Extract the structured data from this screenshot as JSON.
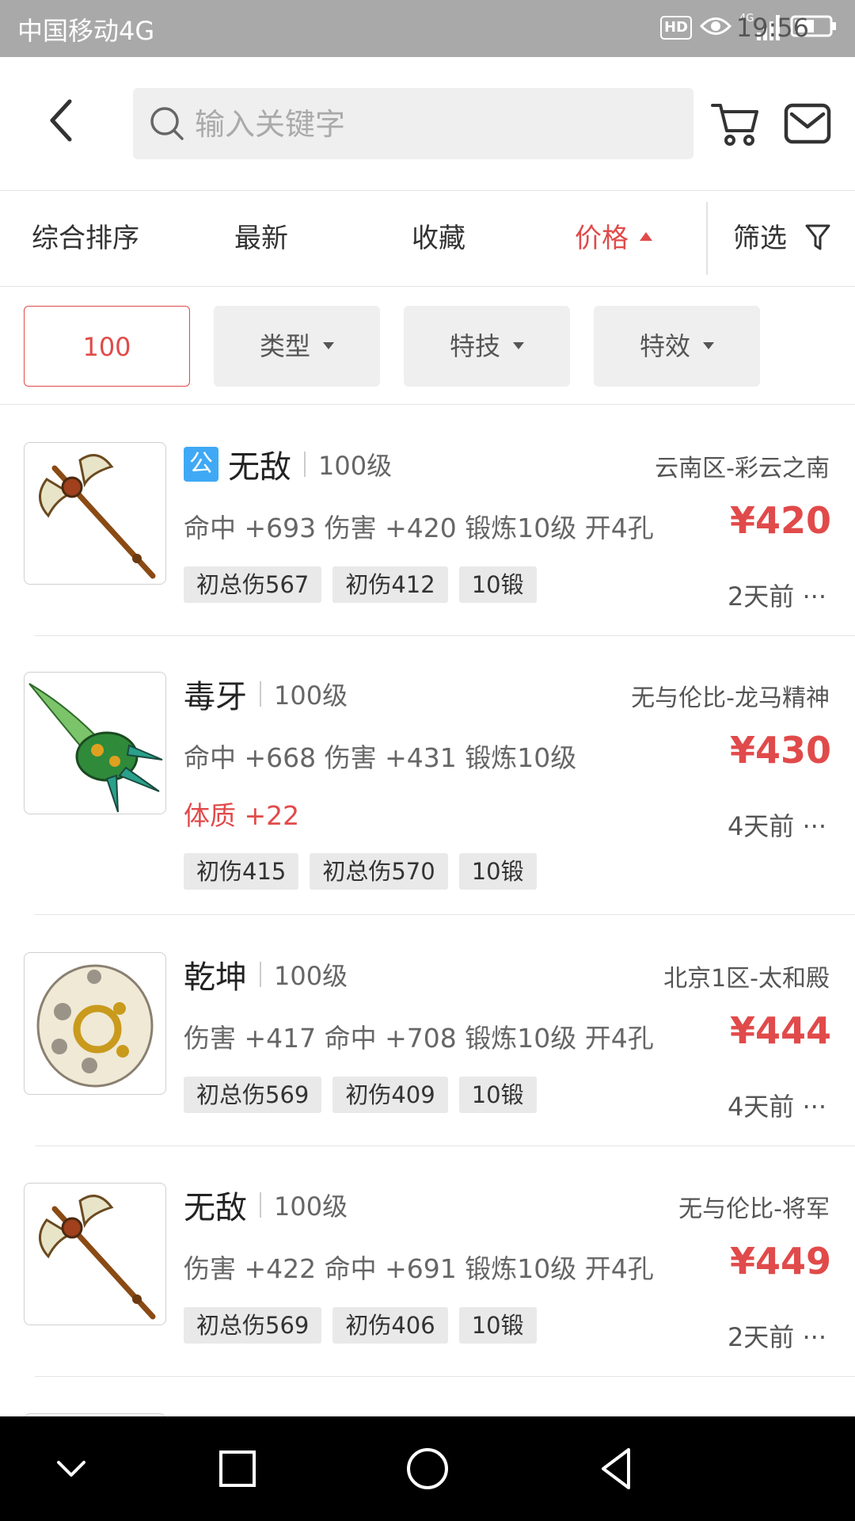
{
  "status_bar": {
    "carrier": "中国移动4G",
    "hd": "HD",
    "network": "4G",
    "time": "19:56"
  },
  "search": {
    "placeholder": "输入关键字"
  },
  "sort_tabs": [
    {
      "label": "综合排序"
    },
    {
      "label": "最新"
    },
    {
      "label": "收藏"
    },
    {
      "label": "价格",
      "active": true
    }
  ],
  "filter_label": "筛选",
  "chips": [
    {
      "label": "100"
    },
    {
      "label": "类型"
    },
    {
      "label": "特技"
    },
    {
      "label": "特效"
    }
  ],
  "items": [
    {
      "badge": "公",
      "name": "无敌",
      "level": "100级",
      "server": "云南区-彩云之南",
      "attrs": "命中 +693 伤害 +420 锻炼10级 开4孔",
      "price": "¥420",
      "tags": [
        "初总伤567",
        "初伤412",
        "10锻"
      ],
      "time": "2天前 ···"
    },
    {
      "name": "毒牙",
      "level": "100级",
      "server": "无与伦比-龙马精神",
      "attrs": "命中 +668 伤害 +431 锻炼10级",
      "extra": "体质 +22",
      "price": "¥430",
      "tags": [
        "初伤415",
        "初总伤570",
        "10锻"
      ],
      "time": "4天前 ···"
    },
    {
      "name": "乾坤",
      "level": "100级",
      "server": "北京1区-太和殿",
      "attrs": "伤害 +417 命中 +708 锻炼10级 开4孔",
      "price": "¥444",
      "tags": [
        "初总伤569",
        "初伤409",
        "10锻"
      ],
      "time": "4天前 ···"
    },
    {
      "name": "无敌",
      "level": "100级",
      "server": "无与伦比-将军",
      "attrs": "伤害 +422 命中 +691 锻炼10级 开4孔",
      "price": "¥449",
      "tags": [
        "初总伤569",
        "初伤406",
        "10锻"
      ],
      "time": "2天前 ···"
    }
  ],
  "colors": {
    "accent": "#e14a4a",
    "badge": "#3fa9f5",
    "status_bar": "#a9a9a9"
  }
}
